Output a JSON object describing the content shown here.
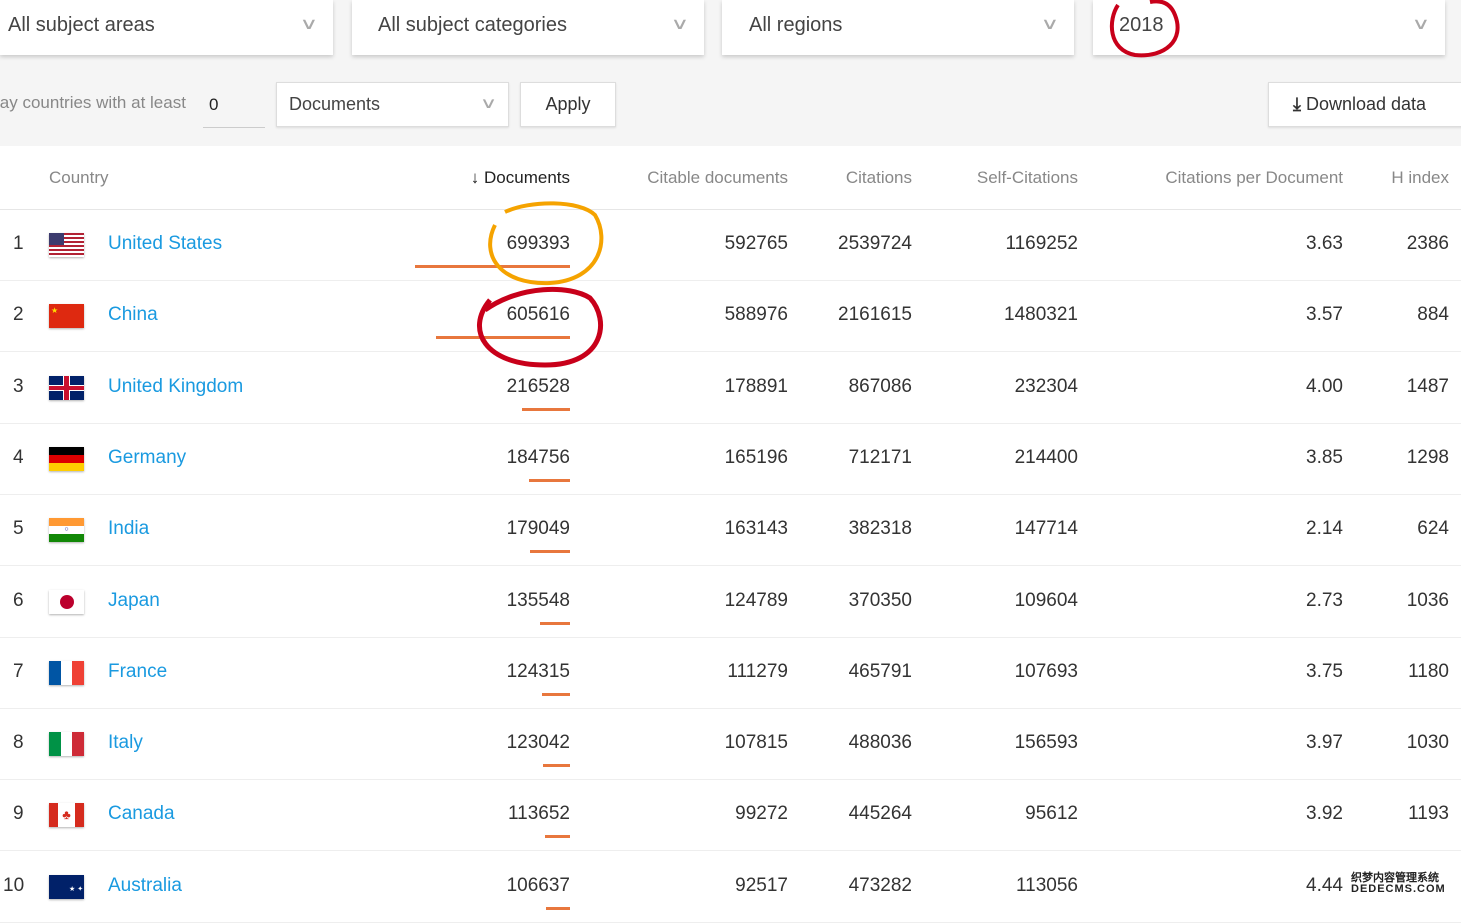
{
  "filters": {
    "subject_area": "All subject areas",
    "subject_category": "All subject categories",
    "region": "All regions",
    "year": "2018"
  },
  "toolbar": {
    "min_label": "lay countries with at least",
    "min_value": "0",
    "metric": "Documents",
    "apply": "Apply",
    "download": "Download data"
  },
  "columns": {
    "country": "Country",
    "documents": "Documents",
    "citable": "Citable documents",
    "citations": "Citations",
    "self": "Self-Citations",
    "cpd": "Citations per Document",
    "h": "H index"
  },
  "sort_icon": "arrow-down-icon",
  "bar_color": "#e8773d",
  "rows": [
    {
      "rank": "1",
      "country": "United States",
      "flag": "us",
      "documents": "699393",
      "citable": "592765",
      "citations": "2539724",
      "self": "1169252",
      "cpd": "3.63",
      "h": "2386"
    },
    {
      "rank": "2",
      "country": "China",
      "flag": "cn",
      "documents": "605616",
      "citable": "588976",
      "citations": "2161615",
      "self": "1480321",
      "cpd": "3.57",
      "h": "884"
    },
    {
      "rank": "3",
      "country": "United Kingdom",
      "flag": "gb",
      "documents": "216528",
      "citable": "178891",
      "citations": "867086",
      "self": "232304",
      "cpd": "4.00",
      "h": "1487"
    },
    {
      "rank": "4",
      "country": "Germany",
      "flag": "de",
      "documents": "184756",
      "citable": "165196",
      "citations": "712171",
      "self": "214400",
      "cpd": "3.85",
      "h": "1298"
    },
    {
      "rank": "5",
      "country": "India",
      "flag": "in",
      "documents": "179049",
      "citable": "163143",
      "citations": "382318",
      "self": "147714",
      "cpd": "2.14",
      "h": "624"
    },
    {
      "rank": "6",
      "country": "Japan",
      "flag": "jp",
      "documents": "135548",
      "citable": "124789",
      "citations": "370350",
      "self": "109604",
      "cpd": "2.73",
      "h": "1036"
    },
    {
      "rank": "7",
      "country": "France",
      "flag": "fr",
      "documents": "124315",
      "citable": "111279",
      "citations": "465791",
      "self": "107693",
      "cpd": "3.75",
      "h": "1180"
    },
    {
      "rank": "8",
      "country": "Italy",
      "flag": "it",
      "documents": "123042",
      "citable": "107815",
      "citations": "488036",
      "self": "156593",
      "cpd": "3.97",
      "h": "1030"
    },
    {
      "rank": "9",
      "country": "Canada",
      "flag": "ca",
      "documents": "113652",
      "citable": "99272",
      "citations": "445264",
      "self": "95612",
      "cpd": "3.92",
      "h": "1193"
    },
    {
      "rank": "10",
      "country": "Australia",
      "flag": "au",
      "documents": "106637",
      "citable": "92517",
      "citations": "473282",
      "self": "113056",
      "cpd": "4.44",
      "h": ""
    }
  ],
  "watermark": {
    "line1": "织梦内容管理系统",
    "line2": "DEDECMS.COM"
  }
}
